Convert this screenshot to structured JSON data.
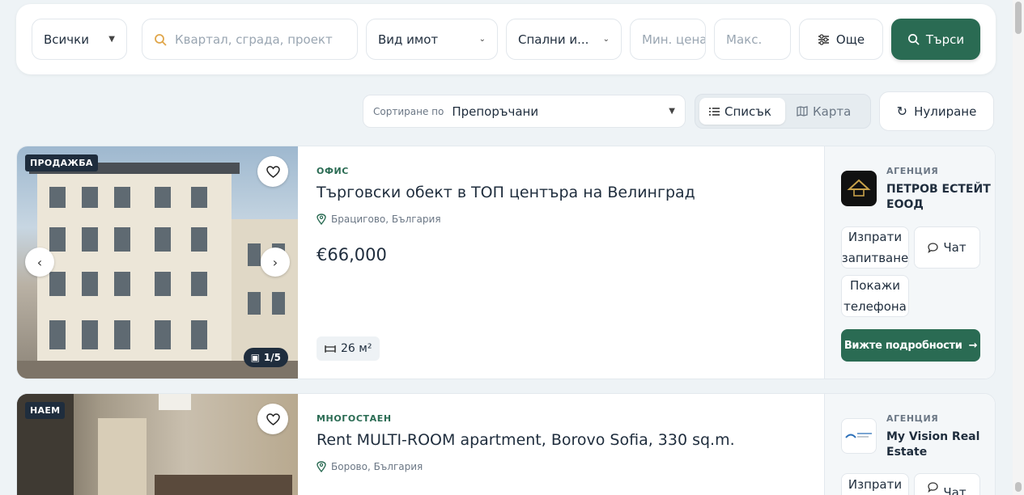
{
  "search": {
    "type_value": "Всички",
    "query_placeholder": "Квартал, сграда, проект",
    "property_type": "Вид имот",
    "bedrooms": "Спални и...",
    "min_placeholder": "Мин. цена",
    "max_placeholder": "Макс.",
    "more_label": "Още",
    "search_label": "Търси"
  },
  "toolbar": {
    "sort_label": "Сортиране по",
    "sort_value": "Препоръчани",
    "list_label": "Списък",
    "map_label": "Карта",
    "reset_label": "Нулиране"
  },
  "colors": {
    "accent": "#2a6b53",
    "dark": "#1f2d3d"
  },
  "listings": [
    {
      "badge": "ПРОДАЖБА",
      "category": "ОФИС",
      "title": "Търговски обект в ТОП центъра на Велинград",
      "location": "Брацигово, България",
      "price": "€66,000",
      "area": "26 м²",
      "photo_counter": "1/5",
      "agency_label": "АГЕНЦИЯ",
      "agency_name": "ПЕТРОВ ЕСТЕЙТ ЕООД",
      "send_inquiry": "Изпрати запитване",
      "chat": "Чат",
      "show_phone": "Покажи телефона",
      "details": "Вижте подробности"
    },
    {
      "badge": "НАЕМ",
      "category": "МНОГОСТАЕН",
      "title": "Rent MULTI-ROOM apartment, Borovo Sofia, 330 sq.m.",
      "location": "Борово, България",
      "agency_label": "АГЕНЦИЯ",
      "agency_name": "My Vision Real Estate",
      "send_inquiry": "Изпрати",
      "chat": "Чат"
    }
  ]
}
